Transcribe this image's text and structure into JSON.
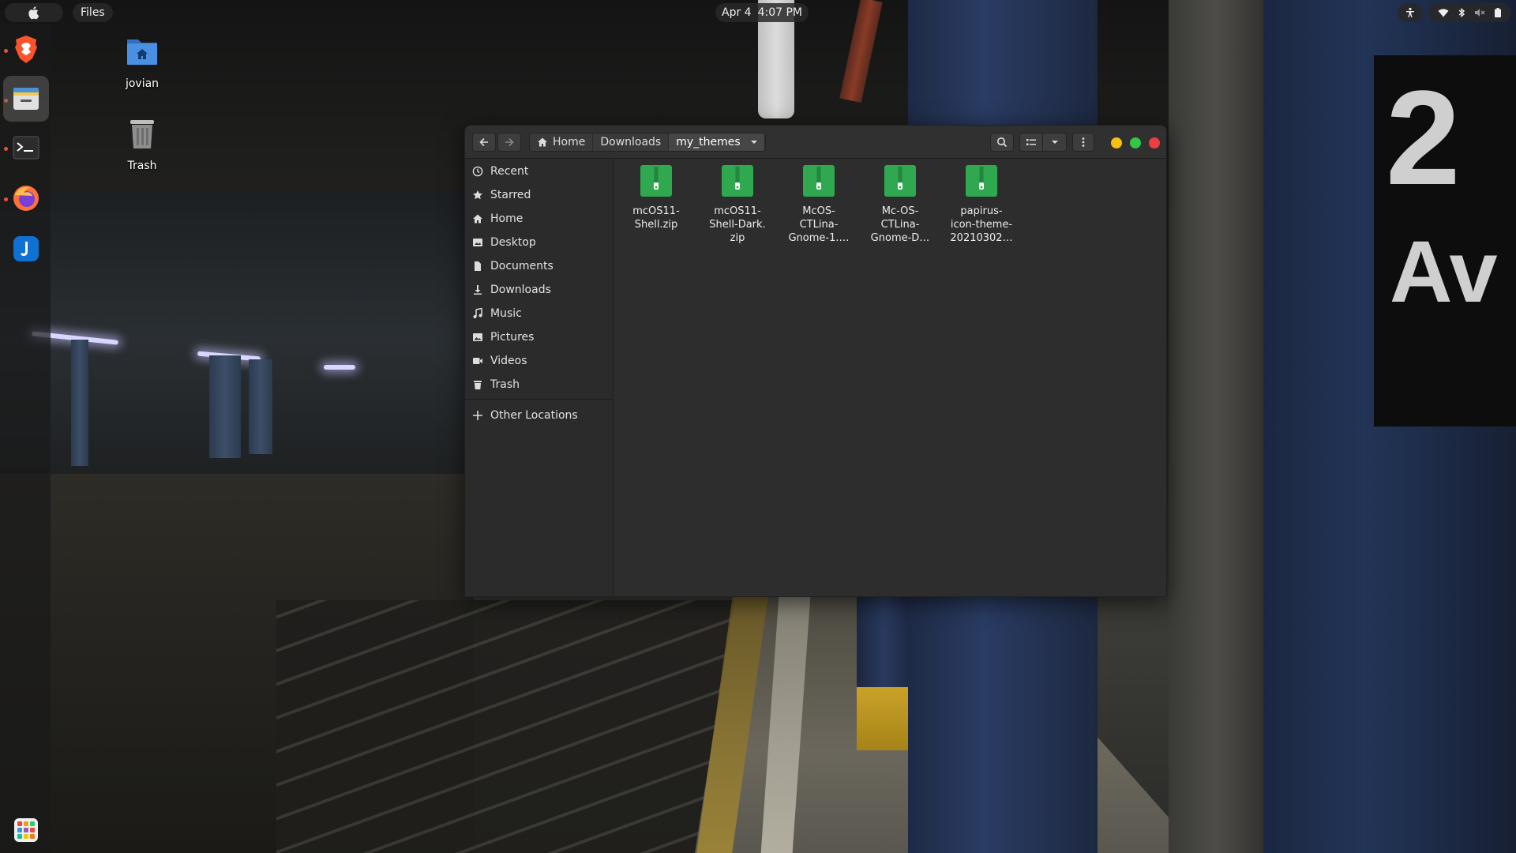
{
  "topbar": {
    "app_menu_label": "Files",
    "date": "Apr 4",
    "time": "4:07 PM",
    "tray_icons": [
      "accessibility-icon",
      "wifi-icon",
      "bluetooth-icon",
      "volume-muted-icon",
      "battery-icon"
    ]
  },
  "dock": {
    "items": [
      {
        "name": "Brave",
        "icon": "brave-icon"
      },
      {
        "name": "Files",
        "icon": "files-icon"
      },
      {
        "name": "Terminal",
        "icon": "terminal-icon"
      },
      {
        "name": "Firefox",
        "icon": "firefox-icon"
      },
      {
        "name": "Joplin",
        "icon": "joplin-icon"
      },
      {
        "name": "Show Applications",
        "icon": "app-grid-icon"
      }
    ]
  },
  "desktop": {
    "icons": [
      {
        "label": "jovian",
        "icon": "home-folder-icon"
      },
      {
        "label": "Trash",
        "icon": "trash-icon"
      }
    ]
  },
  "window": {
    "breadcrumbs": [
      {
        "label": "Home",
        "icon": "home-icon"
      },
      {
        "label": "Downloads"
      },
      {
        "label": "my_themes"
      }
    ],
    "controls": {
      "minimize_color": "#f5c211",
      "maximize_color": "#33c748",
      "close_color": "#ed3f3f"
    },
    "sidebar": {
      "places": [
        {
          "label": "Recent",
          "icon": "clock-icon"
        },
        {
          "label": "Starred",
          "icon": "star-icon"
        },
        {
          "label": "Home",
          "icon": "home-icon"
        },
        {
          "label": "Desktop",
          "icon": "desktop-icon"
        },
        {
          "label": "Documents",
          "icon": "document-icon"
        },
        {
          "label": "Downloads",
          "icon": "download-icon"
        },
        {
          "label": "Music",
          "icon": "music-icon"
        },
        {
          "label": "Pictures",
          "icon": "picture-icon"
        },
        {
          "label": "Videos",
          "icon": "video-icon"
        },
        {
          "label": "Trash",
          "icon": "trash-icon"
        }
      ],
      "other_locations": {
        "label": "Other Locations",
        "icon": "plus-icon"
      }
    },
    "files": [
      {
        "name": "mcOS11-Shell.zip",
        "icon": "zip-archive-icon"
      },
      {
        "name": "mcOS11-Shell-Dark.zip",
        "icon": "zip-archive-icon"
      },
      {
        "name": "McOS-CTLina-Gnome-1.…",
        "icon": "zip-archive-icon"
      },
      {
        "name": "Mc-OS-CTLina-Gnome-D…",
        "icon": "zip-archive-icon"
      },
      {
        "name": "papirus-icon-theme-20210302…",
        "icon": "zip-archive-icon"
      }
    ],
    "file_labels_wrapped": [
      [
        "mcOS11-",
        "Shell.zip"
      ],
      [
        "mcOS11-",
        "Shell-Dark.",
        "zip"
      ],
      [
        "McOS-",
        "CTLina-",
        "Gnome-1.…"
      ],
      [
        "Mc-OS-",
        "CTLina-",
        "Gnome-D…"
      ],
      [
        "papirus-",
        "icon-theme-",
        "20210302…"
      ]
    ],
    "accent_color": "#2fa84f"
  }
}
